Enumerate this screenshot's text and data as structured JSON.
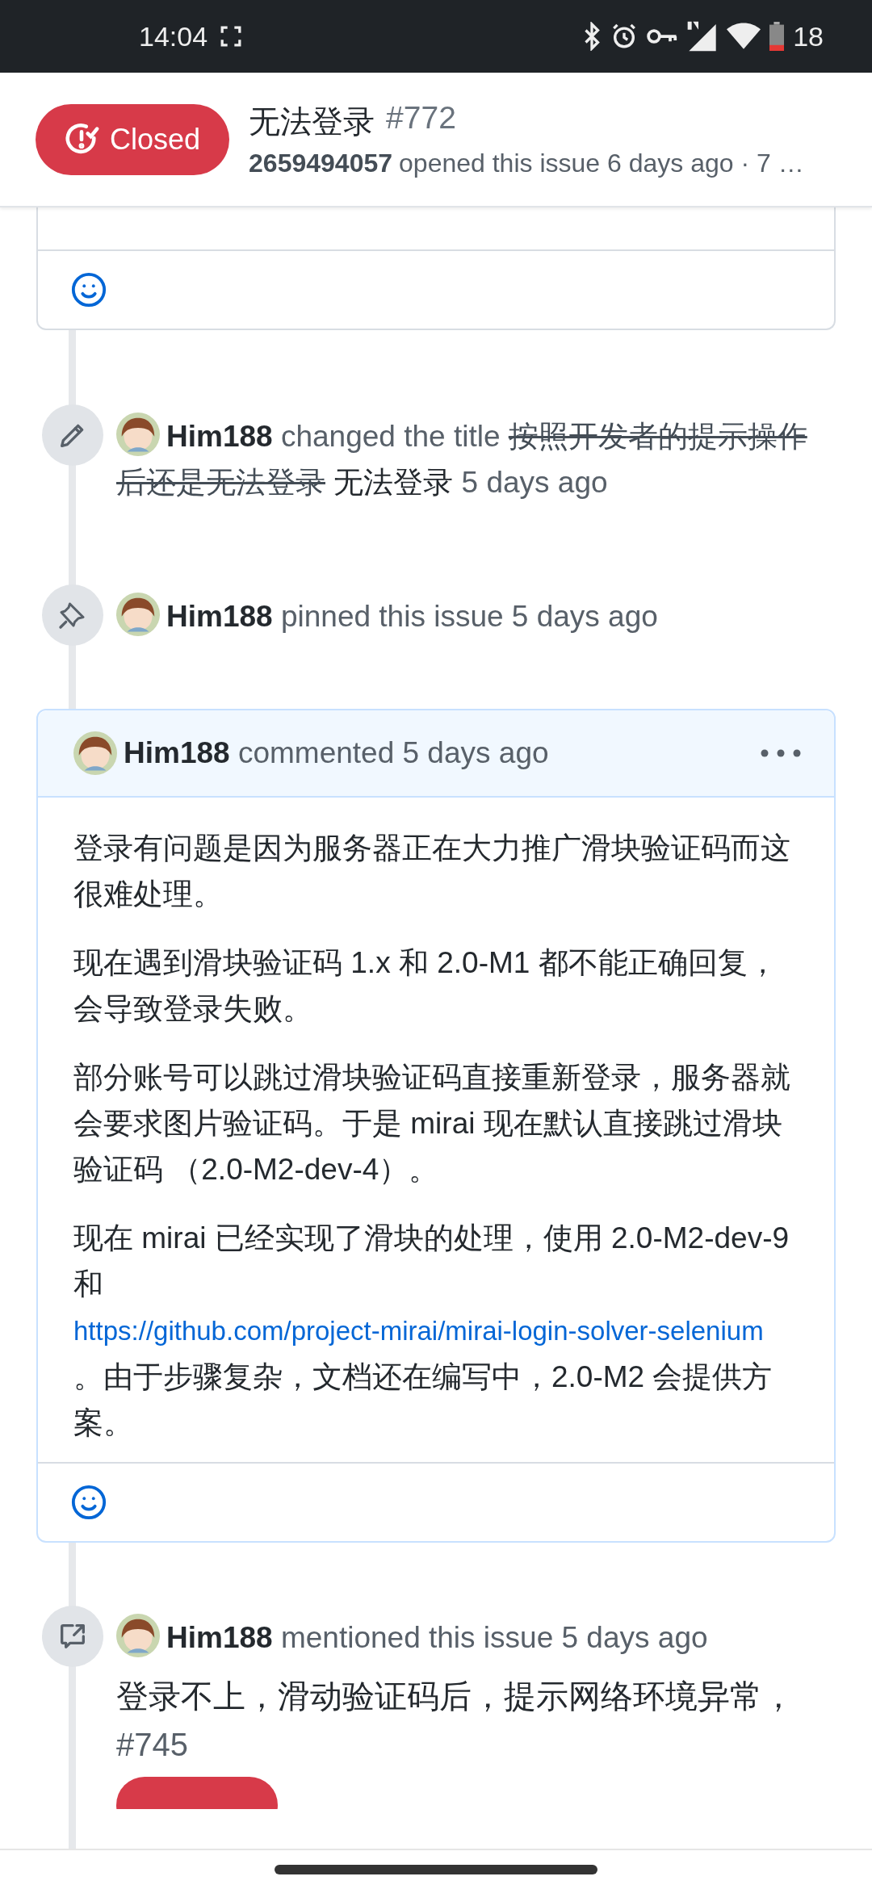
{
  "status_bar": {
    "time": "14:04",
    "battery": "18"
  },
  "header": {
    "state": "Closed",
    "title": "无法登录",
    "number": "#772",
    "author": "2659494057",
    "meta": "opened this issue 6 days ago · 7 …"
  },
  "events": [
    {
      "kind": "renamed",
      "user": "Him188",
      "action": "changed the title",
      "old_title": "按照开发者的提示操作后还是无法登录",
      "new_title": "无法登录",
      "time": "5 days ago"
    },
    {
      "kind": "pinned",
      "user": "Him188",
      "action": "pinned this issue",
      "time": "5 days ago"
    },
    {
      "kind": "comment",
      "user": "Him188",
      "action": "commented",
      "time": "5 days ago",
      "paragraphs": [
        [
          {
            "text": "登录有问题是因为服务器正在大力推广滑块验证码而这很难处理。"
          }
        ],
        [
          {
            "text": "现在遇到滑块验证码 1.x 和 2.0-M1 都不能正确回复，会导致登录失败。"
          }
        ],
        [
          {
            "text": "部分账号可以跳过滑块验证码直接重新登录，服务器就会要求图片验证码。于是 mirai 现在默认直接跳过滑块验证码 （2.0-M2-dev-4）。"
          }
        ],
        [
          {
            "text": "现在 mirai 已经实现了滑块的处理，使用 2.0-M2-dev-9 和 "
          },
          {
            "link": "https://github.com/project-mirai/mirai-login-solver-selenium"
          },
          {
            "text": " 。由于步骤复杂，文档还在编写中，2.0-M2 会提供方案。"
          }
        ]
      ]
    },
    {
      "kind": "mentioned",
      "user": "Him188",
      "action": "mentioned this issue",
      "time": "5 days ago",
      "ref_title": "登录不上，滑动验证码后，提示网络环境异常，",
      "ref_number": "#745",
      "ref_closed": true
    }
  ]
}
